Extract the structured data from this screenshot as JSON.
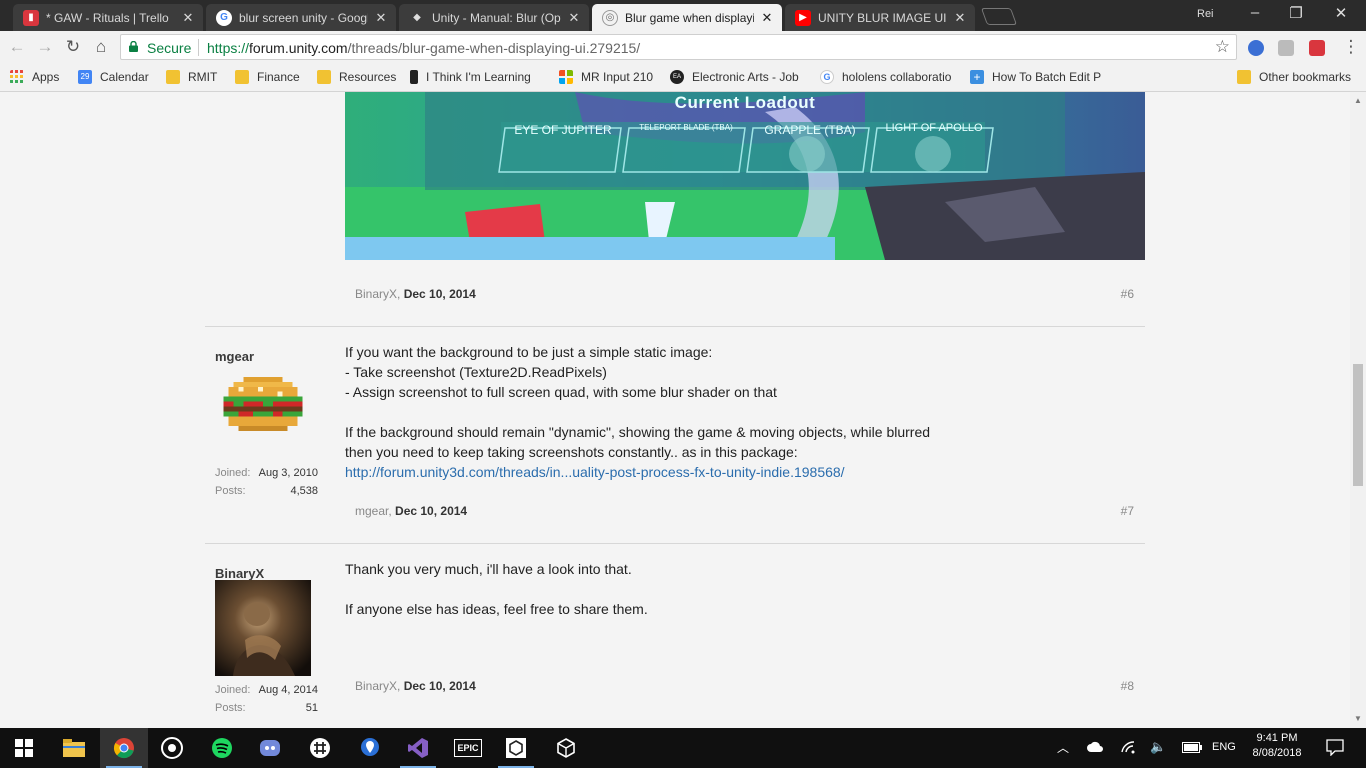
{
  "browser": {
    "tabs": [
      {
        "title": "* GAW - Rituals | Trello",
        "icon": "trello-icon",
        "color": "#d9363e",
        "active": false
      },
      {
        "title": "blur screen unity - Google",
        "icon": "google-icon",
        "color": "#ffffff",
        "active": false
      },
      {
        "title": "Unity - Manual: Blur (Opti",
        "icon": "unity-icon",
        "color": "#dddddd",
        "active": false
      },
      {
        "title": "Blur game when displayin",
        "icon": "unity-forum-icon",
        "color": "#aaaaaa",
        "active": true
      },
      {
        "title": "UNITY BLUR IMAGE UI",
        "icon": "youtube-icon",
        "color": "#ff0000",
        "active": false
      }
    ],
    "profile_name": "Rei",
    "omnibox": {
      "secure_label": "Secure",
      "url_scheme": "https://",
      "url_host": "forum.unity.com",
      "url_path": "/threads/blur-game-when-displaying-ui.279215/"
    },
    "bookmarks": [
      {
        "label": "Apps",
        "icon": "apps-grid-icon"
      },
      {
        "label": "Calendar",
        "icon": "calendar-icon",
        "badge": "29"
      },
      {
        "label": "RMIT",
        "icon": "folder-icon"
      },
      {
        "label": "Finance",
        "icon": "folder-icon"
      },
      {
        "label": "Resources",
        "icon": "folder-icon"
      },
      {
        "label": "I Think I'm Learning",
        "icon": "bookmark-icon"
      },
      {
        "label": "MR Input 210",
        "icon": "microsoft-icon"
      },
      {
        "label": "Electronic Arts - Job",
        "icon": "ea-icon"
      },
      {
        "label": "hololens collaboratio",
        "icon": "google-icon"
      },
      {
        "label": "How To Batch Edit P",
        "icon": "plus-icon"
      },
      {
        "label": "Other bookmarks",
        "icon": "folder-icon"
      }
    ]
  },
  "forum": {
    "screenshot": {
      "heading": "Current Loadout",
      "slots": [
        "EYE OF JUPITER",
        "TELEPORT BLADE (TBA)",
        "GRAPPLE (TBA)",
        "LIGHT OF APOLLO"
      ]
    },
    "posts": [
      {
        "author": "BinaryX",
        "date": "Dec 10, 2014",
        "permalink": "#6"
      },
      {
        "author": "mgear",
        "joined_label": "Joined:",
        "joined": "Aug 3, 2010",
        "posts_label": "Posts:",
        "post_count": "4,538",
        "lines": [
          "If you want the background to be just a simple static image:",
          "- Take screenshot (Texture2D.ReadPixels)",
          "- Assign screenshot to full screen quad, with some blur shader on that",
          "If the background should remain \"dynamic\", showing the game & moving objects, while blurred",
          "then you need to keep taking screenshots constantly.. as in this package:"
        ],
        "link": "http://forum.unity3d.com/threads/in...uality-post-process-fx-to-unity-indie.198568/",
        "date": "Dec 10, 2014",
        "permalink": "#7"
      },
      {
        "author": "BinaryX",
        "joined_label": "Joined:",
        "joined": "Aug 4, 2014",
        "posts_label": "Posts:",
        "post_count": "51",
        "lines": [
          "Thank you very much, i'll have a look into that.",
          "If anyone else has ideas, feel free to share them."
        ],
        "date": "Dec 10, 2014",
        "permalink": "#8"
      }
    ]
  },
  "taskbar": {
    "apps": [
      "windows-start-icon",
      "file-explorer-icon",
      "chrome-icon",
      "obs-icon",
      "spotify-icon",
      "discord-icon",
      "slack-icon",
      "maps-pin-icon",
      "visual-studio-icon",
      "epic-games-icon",
      "unity-icon",
      "unity-hub-icon"
    ],
    "epic_label": "EPIC",
    "language": "ENG",
    "time": "9:41 PM",
    "date": "8/08/2018"
  }
}
